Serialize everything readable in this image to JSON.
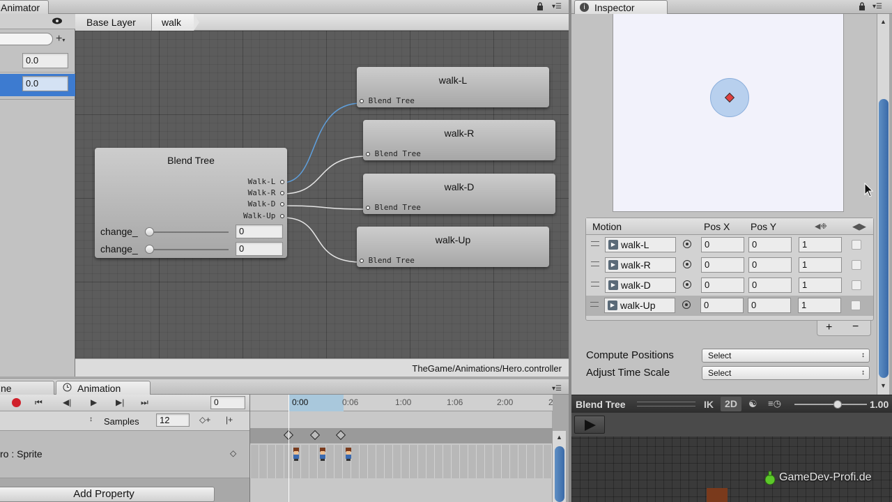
{
  "animator": {
    "tab_label": "Animator",
    "param_values": [
      "0.0",
      "0.0"
    ],
    "breadcrumbs": [
      "Base Layer",
      "walk"
    ],
    "path": "TheGame/Animations/Hero.controller",
    "blend_tree_node": {
      "title": "Blend Tree",
      "outputs": [
        "Walk-L",
        "Walk-R",
        "Walk-D",
        "Walk-Up"
      ],
      "params": [
        {
          "label": "change_",
          "value": "0"
        },
        {
          "label": "change_",
          "value": "0"
        }
      ]
    },
    "motion_nodes": [
      {
        "title": "walk-L",
        "port": "Blend Tree"
      },
      {
        "title": "walk-R",
        "port": "Blend Tree"
      },
      {
        "title": "walk-D",
        "port": "Blend Tree"
      },
      {
        "title": "walk-Up",
        "port": "Blend Tree"
      }
    ],
    "colors": {
      "grid_bg": "#5c5c5c",
      "link_selected": "#5f9fdc",
      "link": "#e6e6e6"
    }
  },
  "inspector": {
    "tab_label": "Inspector",
    "motion_table": {
      "headers": {
        "motion": "Motion",
        "pos_x": "Pos X",
        "pos_y": "Pos Y"
      },
      "rows": [
        {
          "clip": "walk-L",
          "pos_x": "0",
          "pos_y": "0",
          "speed": "1"
        },
        {
          "clip": "walk-R",
          "pos_x": "0",
          "pos_y": "0",
          "speed": "1"
        },
        {
          "clip": "walk-D",
          "pos_x": "0",
          "pos_y": "0",
          "speed": "1"
        },
        {
          "clip": "walk-Up",
          "pos_x": "0",
          "pos_y": "0",
          "speed": "1"
        }
      ],
      "add_label": "+",
      "remove_label": "−"
    },
    "compute_positions": {
      "label": "Compute Positions",
      "value": "Select"
    },
    "adjust_time_scale": {
      "label": "Adjust Time Scale",
      "value": "Select"
    },
    "preview": {
      "title": "Blend Tree",
      "ik_label": "IK",
      "mode_label": "2D",
      "speed_value": "1.00",
      "speed_fraction": 0.6
    }
  },
  "animation": {
    "left_tab_label": "ne",
    "tab_label": "Animation",
    "frame_value": "0",
    "samples_label": "Samples",
    "samples_value": "12",
    "ruler_labels": [
      "0:00",
      "0:06",
      "1:00",
      "1:06",
      "2:00",
      "2"
    ],
    "property_label": "ro : Sprite",
    "add_property_label": "Add Property"
  },
  "watermark": "GameDev-Profi.de"
}
